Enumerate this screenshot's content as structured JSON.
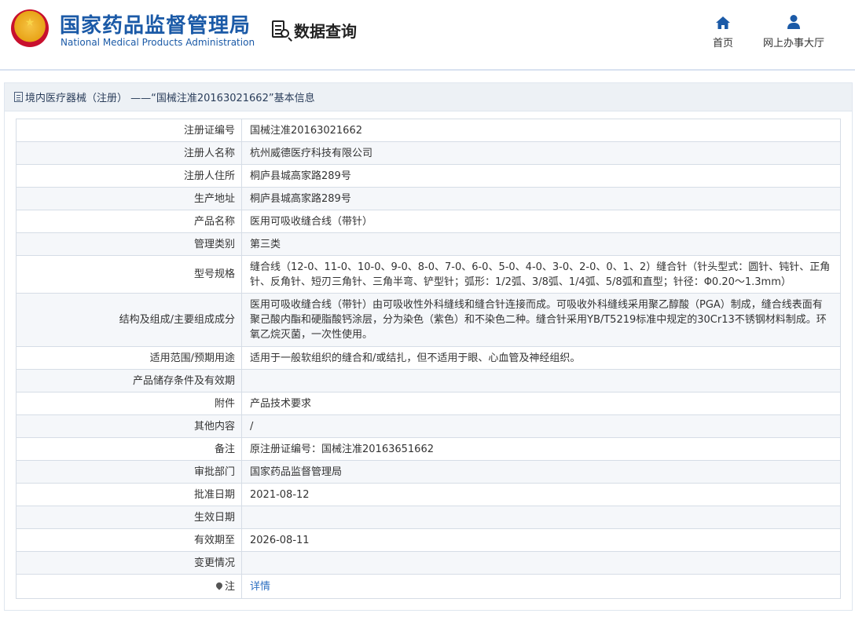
{
  "header": {
    "agency_cn": "国家药品监督管理局",
    "agency_en": "National Medical Products Administration",
    "section_title": "数据查询",
    "nav": [
      {
        "label": "首页",
        "icon": "home-icon"
      },
      {
        "label": "网上办事大厅",
        "icon": "user-icon"
      }
    ]
  },
  "panel": {
    "title": "境内医疗器械（注册） ——“国械注准20163021662”基本信息"
  },
  "fields": [
    {
      "label": "注册证编号",
      "value": "国械注准20163021662"
    },
    {
      "label": "注册人名称",
      "value": "杭州威德医疗科技有限公司"
    },
    {
      "label": "注册人住所",
      "value": "桐庐县城高家路289号"
    },
    {
      "label": "生产地址",
      "value": "桐庐县城高家路289号"
    },
    {
      "label": "产品名称",
      "value": "医用可吸收缝合线（带针）"
    },
    {
      "label": "管理类别",
      "value": "第三类"
    },
    {
      "label": "型号规格",
      "value": "缝合线（12-0、11-0、10-0、9-0、8-0、7-0、6-0、5-0、4-0、3-0、2-0、0、1、2）缝合针（针头型式：圆针、钝针、正角针、反角针、短刃三角针、三角半弯、铲型针；弧形：1/2弧、3/8弧、1/4弧、5/8弧和直型；针径：Φ0.20～1.3mm）"
    },
    {
      "label": "结构及组成/主要组成成分",
      "value": "医用可吸收缝合线（带针）由可吸收性外科缝线和缝合针连接而成。可吸收外科缝线采用聚乙醇酸（PGA）制成，缝合线表面有聚己酸内酯和硬脂酸钙涂层，分为染色（紫色）和不染色二种。缝合针采用YB/T5219标准中规定的30Cr13不锈钢材料制成。环氧乙烷灭菌，一次性使用。"
    },
    {
      "label": "适用范围/预期用途",
      "value": "适用于一般软组织的缝合和/或结扎，但不适用于眼、心血管及神经组织。"
    },
    {
      "label": "产品储存条件及有效期",
      "value": ""
    },
    {
      "label": "附件",
      "value": "产品技术要求"
    },
    {
      "label": "其他内容",
      "value": "/"
    },
    {
      "label": "备注",
      "value": "原注册证编号：国械注准20163651662"
    },
    {
      "label": "审批部门",
      "value": "国家药品监督管理局"
    },
    {
      "label": "批准日期",
      "value": "2021-08-12"
    },
    {
      "label": "生效日期",
      "value": ""
    },
    {
      "label": "有效期至",
      "value": "2026-08-11"
    },
    {
      "label": "变更情况",
      "value": ""
    }
  ],
  "note_row": {
    "label": "注",
    "value": "详情"
  }
}
